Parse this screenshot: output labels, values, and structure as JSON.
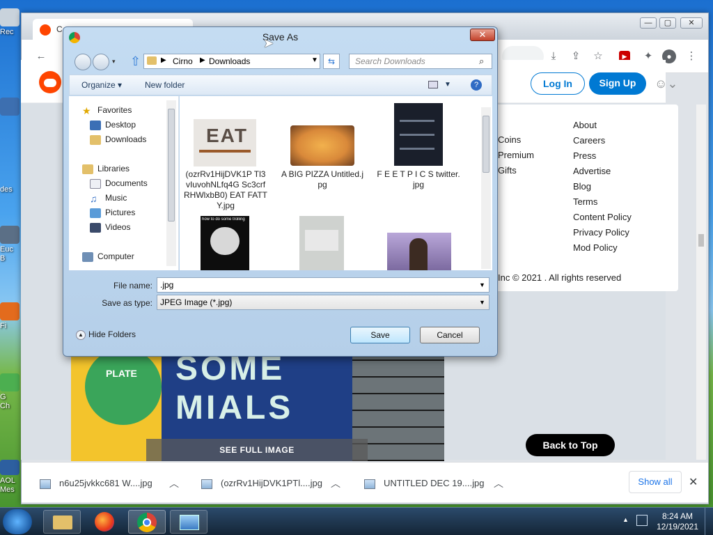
{
  "desktop": {
    "icons": [
      {
        "label": "Rec"
      },
      {
        "label": "des"
      },
      {
        "label": "Euc"
      },
      {
        "label": "B"
      },
      {
        "label": "Fi"
      },
      {
        "label": "G"
      },
      {
        "label": "Ch"
      },
      {
        "label": "AOL"
      },
      {
        "label": "Mes"
      }
    ]
  },
  "browser": {
    "tab_label": "C",
    "toolbar_icons": [
      "back-icon",
      "download-icon",
      "share-icon",
      "star-icon",
      "youtube-icon",
      "extensions-icon",
      "profile-icon",
      "menu-icon"
    ]
  },
  "reddit": {
    "login_label": "Log In",
    "signup_label": "Sign Up",
    "footer_left": [
      "Coins",
      "Premium",
      "Gifts"
    ],
    "footer_right": [
      "About",
      "Careers",
      "Press",
      "Advertise",
      "Blog",
      "Terms",
      "Content Policy",
      "Privacy Policy",
      "Mod Policy"
    ],
    "copyright": "Inc © 2021 . All rights reserved",
    "post_image_text": [
      "PLATE",
      "SOME",
      "MIALS"
    ],
    "see_full_image": "SEE FULL IMAGE",
    "back_to_top": "Back to Top"
  },
  "downloads_bar": {
    "items": [
      {
        "name": "n6u25jvkkc681 W....jpg"
      },
      {
        "name": "(ozrRv1HijDVK1PTl....jpg"
      },
      {
        "name": "UNTITLED DEC 19....jpg"
      }
    ],
    "show_all": "Show all"
  },
  "dialog": {
    "title": "Save As",
    "path": [
      "Cirno",
      "Downloads"
    ],
    "search_placeholder": "Search Downloads",
    "organize_label": "Organize",
    "new_folder_label": "New folder",
    "nav": {
      "favorites": "Favorites",
      "favorites_items": [
        "Desktop",
        "Downloads"
      ],
      "libraries": "Libraries",
      "libraries_items": [
        "Documents",
        "Music",
        "Pictures",
        "Videos"
      ],
      "computer": "Computer"
    },
    "files": [
      {
        "name": "(ozrRv1HijDVK1P Tl3vIuvohNLfq4G Sc3crfRHWlxbB0) EAT FATTY.jpg",
        "thumb_text": "EAT"
      },
      {
        "name": "A BIG PIZZA Untitled.jpg"
      },
      {
        "name": "F E E T P I C S twitter.jpg"
      },
      {
        "name": "",
        "thumb_text": "how to do some trolling"
      },
      {
        "name": ""
      },
      {
        "name": ""
      }
    ],
    "file_name_label": "File name:",
    "file_name_value": ".jpg",
    "save_as_type_label": "Save as type:",
    "save_as_type_value": "JPEG Image (*.jpg)",
    "hide_folders": "Hide Folders",
    "save_button": "Save",
    "cancel_button": "Cancel"
  },
  "taskbar": {
    "time": "8:24 AM",
    "date": "12/19/2021"
  }
}
